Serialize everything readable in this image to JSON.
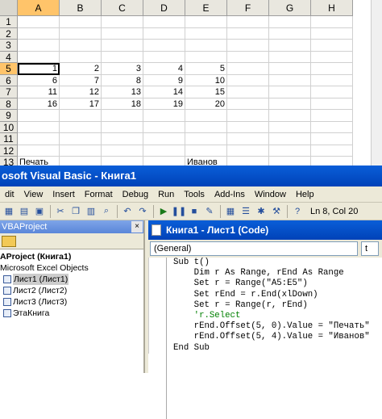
{
  "excel": {
    "columns": [
      "A",
      "B",
      "C",
      "D",
      "E",
      "F",
      "G",
      "H"
    ],
    "selected_column": "A",
    "rows": [
      {
        "n": "1",
        "cells": [
          "",
          "",
          "",
          "",
          "",
          "",
          "",
          ""
        ]
      },
      {
        "n": "2",
        "cells": [
          "",
          "",
          "",
          "",
          "",
          "",
          "",
          ""
        ]
      },
      {
        "n": "3",
        "cells": [
          "",
          "",
          "",
          "",
          "",
          "",
          "",
          ""
        ]
      },
      {
        "n": "4",
        "cells": [
          "",
          "",
          "",
          "",
          "",
          "",
          "",
          ""
        ]
      },
      {
        "n": "5",
        "cells": [
          "1",
          "2",
          "3",
          "4",
          "5",
          "",
          "",
          ""
        ]
      },
      {
        "n": "6",
        "cells": [
          "6",
          "7",
          "8",
          "9",
          "10",
          "",
          "",
          ""
        ]
      },
      {
        "n": "7",
        "cells": [
          "11",
          "12",
          "13",
          "14",
          "15",
          "",
          "",
          ""
        ]
      },
      {
        "n": "8",
        "cells": [
          "16",
          "17",
          "18",
          "19",
          "20",
          "",
          "",
          ""
        ]
      },
      {
        "n": "9",
        "cells": [
          "",
          "",
          "",
          "",
          "",
          "",
          "",
          ""
        ]
      },
      {
        "n": "10",
        "cells": [
          "",
          "",
          "",
          "",
          "",
          "",
          "",
          ""
        ]
      },
      {
        "n": "11",
        "cells": [
          "",
          "",
          "",
          "",
          "",
          "",
          "",
          ""
        ]
      },
      {
        "n": "12",
        "cells": [
          "",
          "",
          "",
          "",
          "",
          "",
          "",
          ""
        ]
      },
      {
        "n": "13",
        "cells": [
          "Печать",
          "",
          "",
          "",
          "Иванов",
          "",
          "",
          ""
        ]
      }
    ]
  },
  "vbe": {
    "title": "osoft Visual Basic - Книга1",
    "menu": [
      "dit",
      "View",
      "Insert",
      "Format",
      "Debug",
      "Run",
      "Tools",
      "Add-Ins",
      "Window",
      "Help"
    ],
    "status": "Ln 8, Col 20",
    "project": {
      "header": "VBAProject",
      "close_label": "×",
      "items": [
        {
          "label": "AProject (Книга1)",
          "bold": true,
          "indent": 0
        },
        {
          "label": "Microsoft Excel Objects",
          "bold": false,
          "indent": 0
        },
        {
          "label": "Лист1 (Лист1)",
          "bold": false,
          "indent": 1
        },
        {
          "label": "Лист2 (Лист2)",
          "bold": false,
          "indent": 1
        },
        {
          "label": "Лист3 (Лист3)",
          "bold": false,
          "indent": 1
        },
        {
          "label": "ЭтаКнига",
          "bold": false,
          "indent": 1
        }
      ]
    },
    "code_window": {
      "title": "Книга1 - Лист1 (Code)",
      "object_combo": "(General)",
      "proc_combo": "t",
      "lines": [
        "Sub t()",
        "    Dim r As Range, rEnd As Range",
        "    Set r = Range(\"A5:E5\")",
        "    Set rEnd = r.End(xlDown)",
        "    Set r = Range(r, rEnd)",
        "    'r.Select",
        "",
        "    rEnd.Offset(5, 0).Value = \"Печать\"",
        "    rEnd.Offset(5, 4).Value = \"Иванов\"",
        "End Sub"
      ]
    }
  }
}
